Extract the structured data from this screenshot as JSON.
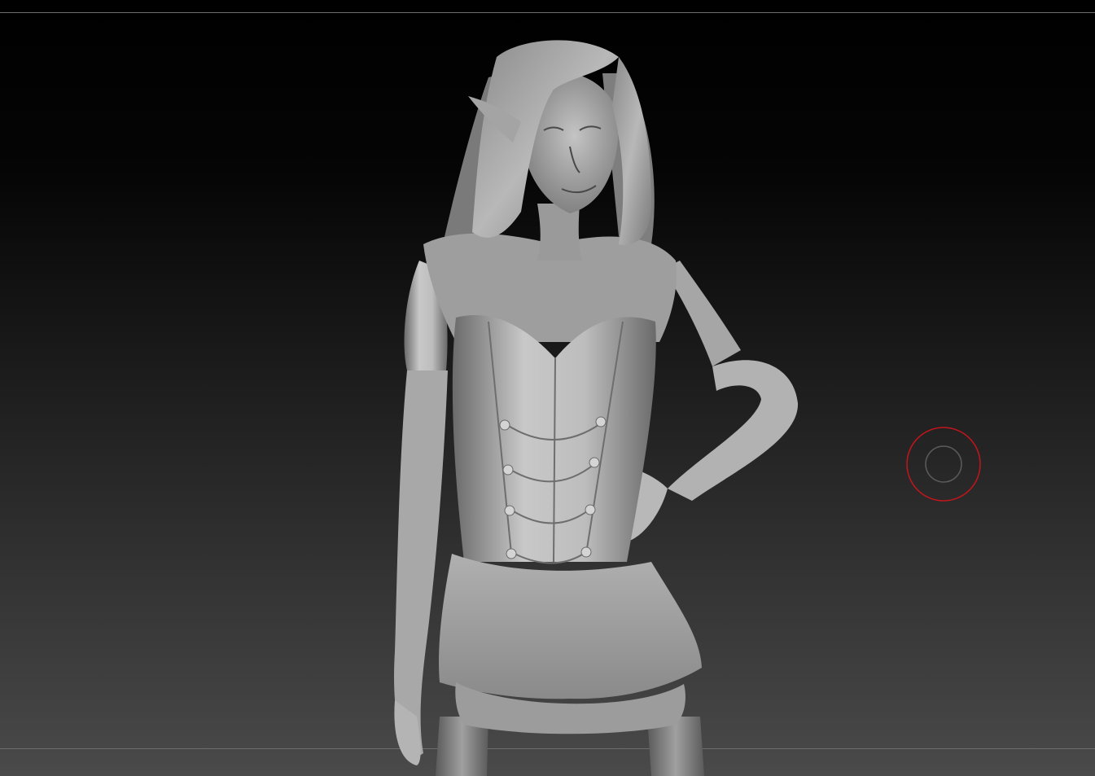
{
  "viewport": {
    "background_top": "#000000",
    "background_bottom": "#4a4a4a",
    "rule_color": "#6e6e6e"
  },
  "model": {
    "material_light": "#c8c8c8",
    "material_mid": "#9a9a9a",
    "material_dark": "#555555"
  },
  "brush_cursor": {
    "icon": "brush-cursor-icon",
    "outer_color": "#c0161c",
    "inner_color": "#5a5a5a"
  }
}
